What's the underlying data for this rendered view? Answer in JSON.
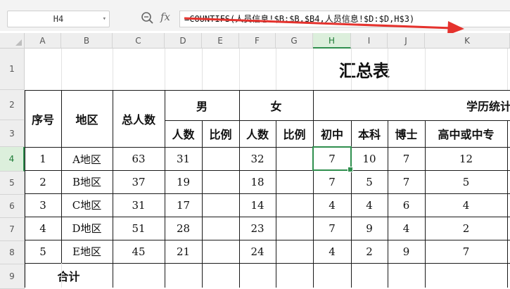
{
  "formula_bar": {
    "name_box": "H4",
    "fx_label": "fx",
    "formula": "=COUNTIFS(人员信息!$B:$B,$B4,人员信息!$D:$D,H$3)"
  },
  "columns": [
    "A",
    "B",
    "C",
    "D",
    "E",
    "F",
    "G",
    "H",
    "I",
    "J",
    "K"
  ],
  "rows": [
    "1",
    "2",
    "3",
    "4",
    "5",
    "6",
    "7",
    "8",
    "9"
  ],
  "sheet": {
    "title": "汇总表",
    "h_seq": "序号",
    "h_region": "地区",
    "h_total": "总人数",
    "h_male": "男",
    "h_female": "女",
    "h_edu": "学历统计",
    "h_count_m": "人数",
    "h_ratio_m": "比例",
    "h_count_f": "人数",
    "h_ratio_f": "比例",
    "h_chuzhong": "初中",
    "h_benke": "本科",
    "h_boshi": "博士",
    "h_gaozhong": "高中或中专",
    "data": [
      {
        "seq": "1",
        "region": "A地区",
        "total": "63",
        "male": "31",
        "female": "32",
        "chuzhong": "7",
        "benke": "10",
        "boshi": "7",
        "gaozhong": "12"
      },
      {
        "seq": "2",
        "region": "B地区",
        "total": "37",
        "male": "19",
        "female": "18",
        "chuzhong": "7",
        "benke": "5",
        "boshi": "7",
        "gaozhong": "5"
      },
      {
        "seq": "3",
        "region": "C地区",
        "total": "31",
        "male": "17",
        "female": "14",
        "chuzhong": "4",
        "benke": "4",
        "boshi": "6",
        "gaozhong": "4"
      },
      {
        "seq": "4",
        "region": "D地区",
        "total": "51",
        "male": "28",
        "female": "23",
        "chuzhong": "7",
        "benke": "9",
        "boshi": "4",
        "gaozhong": "2"
      },
      {
        "seq": "5",
        "region": "E地区",
        "total": "45",
        "male": "21",
        "female": "24",
        "chuzhong": "4",
        "benke": "2",
        "boshi": "9",
        "gaozhong": "7"
      }
    ],
    "total_label": "合计"
  },
  "colors": {
    "selection": "#2f8f4e",
    "arrow": "#e5322d"
  },
  "icons": {
    "zoom": "zoom-icon",
    "dropdown": "chevron-down-icon"
  }
}
